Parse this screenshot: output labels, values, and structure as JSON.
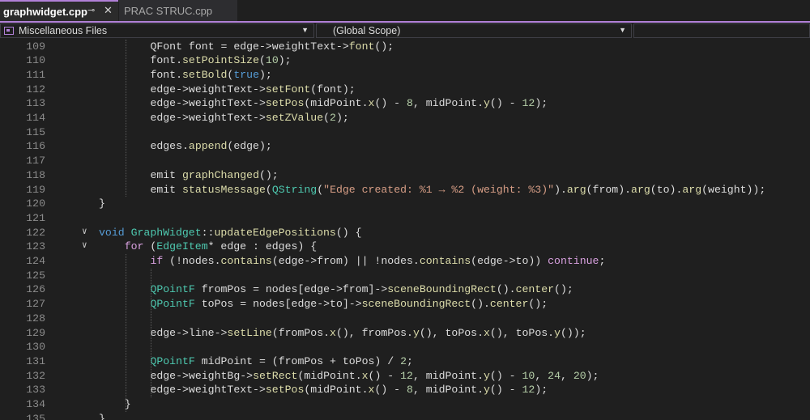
{
  "tabs": [
    {
      "label": "graphwidget.cpp",
      "active": true,
      "pin_icon": "pin-icon",
      "close_icon": "close-icon"
    },
    {
      "label": "PRAC STRUC.cpp",
      "active": false
    }
  ],
  "nav": {
    "project_label": "Miscellaneous Files",
    "scope_label": "(Global Scope)",
    "members_label": ""
  },
  "colors": {
    "accent": "#b180d7",
    "keyword": "#569cd6",
    "control": "#d8a0df",
    "function": "#dcdcaa",
    "type": "#4ec9b0",
    "number": "#b5cea8",
    "string": "#d69d85"
  },
  "editor": {
    "lines": [
      {
        "n": "109",
        "indent": 8,
        "fold": false,
        "tokens": [
          [
            "pl",
            "QFont font = edge->weightText->"
          ],
          [
            "fn",
            "font"
          ],
          [
            "pl",
            "();"
          ]
        ]
      },
      {
        "n": "110",
        "indent": 8,
        "fold": false,
        "tokens": [
          [
            "pl",
            "font."
          ],
          [
            "fn",
            "setPointSize"
          ],
          [
            "pl",
            "("
          ],
          [
            "num",
            "10"
          ],
          [
            "pl",
            ");"
          ]
        ]
      },
      {
        "n": "111",
        "indent": 8,
        "fold": false,
        "tokens": [
          [
            "pl",
            "font."
          ],
          [
            "fn",
            "setBold"
          ],
          [
            "pl",
            "("
          ],
          [
            "kw",
            "true"
          ],
          [
            "pl",
            ");"
          ]
        ]
      },
      {
        "n": "112",
        "indent": 8,
        "fold": false,
        "tokens": [
          [
            "pl",
            "edge->weightText->"
          ],
          [
            "fn",
            "setFont"
          ],
          [
            "pl",
            "(font);"
          ]
        ]
      },
      {
        "n": "113",
        "indent": 8,
        "fold": false,
        "tokens": [
          [
            "pl",
            "edge->weightText->"
          ],
          [
            "fn",
            "setPos"
          ],
          [
            "pl",
            "(midPoint."
          ],
          [
            "fn",
            "x"
          ],
          [
            "pl",
            "() - "
          ],
          [
            "num",
            "8"
          ],
          [
            "pl",
            ", midPoint."
          ],
          [
            "fn",
            "y"
          ],
          [
            "pl",
            "() - "
          ],
          [
            "num",
            "12"
          ],
          [
            "pl",
            ");"
          ]
        ]
      },
      {
        "n": "114",
        "indent": 8,
        "fold": false,
        "tokens": [
          [
            "pl",
            "edge->weightText->"
          ],
          [
            "fn",
            "setZValue"
          ],
          [
            "pl",
            "("
          ],
          [
            "num",
            "2"
          ],
          [
            "pl",
            ");"
          ]
        ]
      },
      {
        "n": "115",
        "indent": 0,
        "fold": false,
        "tokens": []
      },
      {
        "n": "116",
        "indent": 8,
        "fold": false,
        "tokens": [
          [
            "pl",
            "edges."
          ],
          [
            "fn",
            "append"
          ],
          [
            "pl",
            "(edge);"
          ]
        ]
      },
      {
        "n": "117",
        "indent": 0,
        "fold": false,
        "tokens": []
      },
      {
        "n": "118",
        "indent": 8,
        "fold": false,
        "tokens": [
          [
            "pl",
            "emit "
          ],
          [
            "fn",
            "graphChanged"
          ],
          [
            "pl",
            "();"
          ]
        ]
      },
      {
        "n": "119",
        "indent": 8,
        "fold": false,
        "tokens": [
          [
            "pl",
            "emit "
          ],
          [
            "fn",
            "statusMessage"
          ],
          [
            "pl",
            "("
          ],
          [
            "ty",
            "QString"
          ],
          [
            "pl",
            "("
          ],
          [
            "str",
            "\"Edge created: %1 → %2 (weight: %3)\""
          ],
          [
            "pl",
            ")."
          ],
          [
            "fn",
            "arg"
          ],
          [
            "pl",
            "(from)."
          ],
          [
            "fn",
            "arg"
          ],
          [
            "pl",
            "(to)."
          ],
          [
            "fn",
            "arg"
          ],
          [
            "pl",
            "(weight));"
          ]
        ]
      },
      {
        "n": "120",
        "indent": 0,
        "fold": false,
        "tokens": [
          [
            "pl",
            "}"
          ]
        ]
      },
      {
        "n": "121",
        "indent": 0,
        "fold": false,
        "tokens": []
      },
      {
        "n": "122",
        "indent": 0,
        "fold": true,
        "tokens": [
          [
            "kw",
            "void"
          ],
          [
            "pl",
            " "
          ],
          [
            "ty",
            "GraphWidget"
          ],
          [
            "pl",
            "::"
          ],
          [
            "fn",
            "updateEdgePositions"
          ],
          [
            "pl",
            "() {"
          ]
        ]
      },
      {
        "n": "123",
        "indent": 4,
        "fold": true,
        "tokens": [
          [
            "ctl",
            "for"
          ],
          [
            "pl",
            " ("
          ],
          [
            "ty",
            "EdgeItem"
          ],
          [
            "pl",
            "* edge : edges) {"
          ]
        ]
      },
      {
        "n": "124",
        "indent": 8,
        "fold": false,
        "tokens": [
          [
            "ctl",
            "if"
          ],
          [
            "pl",
            " (!nodes."
          ],
          [
            "fn",
            "contains"
          ],
          [
            "pl",
            "(edge->from) || !nodes."
          ],
          [
            "fn",
            "contains"
          ],
          [
            "pl",
            "(edge->to)) "
          ],
          [
            "ctl",
            "continue"
          ],
          [
            "pl",
            ";"
          ]
        ]
      },
      {
        "n": "125",
        "indent": 0,
        "fold": false,
        "tokens": []
      },
      {
        "n": "126",
        "indent": 8,
        "fold": false,
        "tokens": [
          [
            "ty",
            "QPointF"
          ],
          [
            "pl",
            " fromPos = nodes[edge->from]->"
          ],
          [
            "fn",
            "sceneBoundingRect"
          ],
          [
            "pl",
            "()."
          ],
          [
            "fn",
            "center"
          ],
          [
            "pl",
            "();"
          ]
        ]
      },
      {
        "n": "127",
        "indent": 8,
        "fold": false,
        "tokens": [
          [
            "ty",
            "QPointF"
          ],
          [
            "pl",
            " toPos = nodes[edge->to]->"
          ],
          [
            "fn",
            "sceneBoundingRect"
          ],
          [
            "pl",
            "()."
          ],
          [
            "fn",
            "center"
          ],
          [
            "pl",
            "();"
          ]
        ]
      },
      {
        "n": "128",
        "indent": 0,
        "fold": false,
        "tokens": []
      },
      {
        "n": "129",
        "indent": 8,
        "fold": false,
        "tokens": [
          [
            "pl",
            "edge->line->"
          ],
          [
            "fn",
            "setLine"
          ],
          [
            "pl",
            "(fromPos."
          ],
          [
            "fn",
            "x"
          ],
          [
            "pl",
            "(), fromPos."
          ],
          [
            "fn",
            "y"
          ],
          [
            "pl",
            "(), toPos."
          ],
          [
            "fn",
            "x"
          ],
          [
            "pl",
            "(), toPos."
          ],
          [
            "fn",
            "y"
          ],
          [
            "pl",
            "());"
          ]
        ]
      },
      {
        "n": "130",
        "indent": 0,
        "fold": false,
        "tokens": []
      },
      {
        "n": "131",
        "indent": 8,
        "fold": false,
        "tokens": [
          [
            "ty",
            "QPointF"
          ],
          [
            "pl",
            " midPoint = (fromPos + toPos) / "
          ],
          [
            "num",
            "2"
          ],
          [
            "pl",
            ";"
          ]
        ]
      },
      {
        "n": "132",
        "indent": 8,
        "fold": false,
        "tokens": [
          [
            "pl",
            "edge->weightBg->"
          ],
          [
            "fn",
            "setRect"
          ],
          [
            "pl",
            "(midPoint."
          ],
          [
            "fn",
            "x"
          ],
          [
            "pl",
            "() - "
          ],
          [
            "num",
            "12"
          ],
          [
            "pl",
            ", midPoint."
          ],
          [
            "fn",
            "y"
          ],
          [
            "pl",
            "() - "
          ],
          [
            "num",
            "10"
          ],
          [
            "pl",
            ", "
          ],
          [
            "num",
            "24"
          ],
          [
            "pl",
            ", "
          ],
          [
            "num",
            "20"
          ],
          [
            "pl",
            ");"
          ]
        ]
      },
      {
        "n": "133",
        "indent": 8,
        "fold": false,
        "tokens": [
          [
            "pl",
            "edge->weightText->"
          ],
          [
            "fn",
            "setPos"
          ],
          [
            "pl",
            "(midPoint."
          ],
          [
            "fn",
            "x"
          ],
          [
            "pl",
            "() - "
          ],
          [
            "num",
            "8"
          ],
          [
            "pl",
            ", midPoint."
          ],
          [
            "fn",
            "y"
          ],
          [
            "pl",
            "() - "
          ],
          [
            "num",
            "12"
          ],
          [
            "pl",
            ");"
          ]
        ]
      },
      {
        "n": "134",
        "indent": 4,
        "fold": false,
        "tokens": [
          [
            "pl",
            "}"
          ]
        ]
      },
      {
        "n": "135",
        "indent": 0,
        "fold": false,
        "tokens": [
          [
            "pl",
            "}"
          ]
        ]
      }
    ]
  }
}
